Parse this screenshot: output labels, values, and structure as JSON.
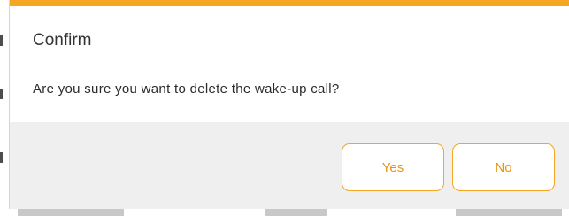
{
  "dialog": {
    "title": "Confirm",
    "message": "Are you sure you want to delete the wake-up call?",
    "accent_color": "#f5a623",
    "buttons": {
      "yes_label": "Yes",
      "no_label": "No"
    }
  }
}
